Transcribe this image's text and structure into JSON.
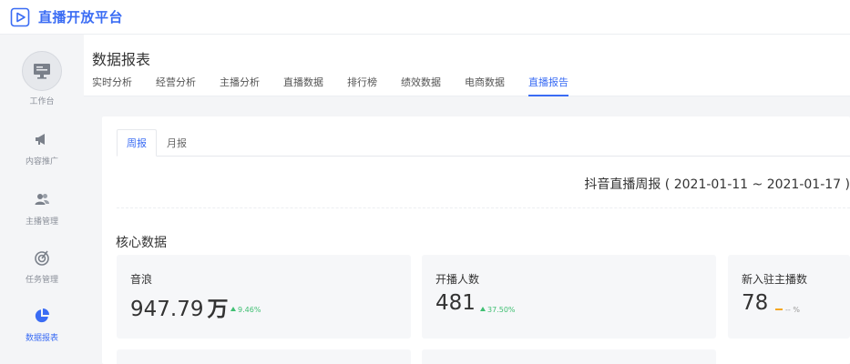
{
  "app": {
    "title": "直播开放平台"
  },
  "sidebar": {
    "items": [
      {
        "label": "工作台",
        "icon": "monitor-icon"
      },
      {
        "label": "内容推广",
        "icon": "megaphone-icon"
      },
      {
        "label": "主播管理",
        "icon": "users-icon"
      },
      {
        "label": "任务管理",
        "icon": "target-icon"
      },
      {
        "label": "数据报表",
        "icon": "pie-chart-icon",
        "active": true
      }
    ]
  },
  "header": {
    "title": "数据报表",
    "tabs": [
      {
        "label": "实时分析"
      },
      {
        "label": "经营分析"
      },
      {
        "label": "主播分析"
      },
      {
        "label": "直播数据"
      },
      {
        "label": "排行榜"
      },
      {
        "label": "绩效数据"
      },
      {
        "label": "电商数据"
      },
      {
        "label": "直播报告",
        "active": true
      }
    ]
  },
  "report": {
    "subtabs": [
      {
        "label": "周报",
        "active": true
      },
      {
        "label": "月报"
      }
    ],
    "title": "抖音直播周报 ( 2021-01-11 ~ 2021-01-17 )",
    "section_title": "核心数据",
    "metrics": [
      {
        "label": "音浪",
        "value": "947.79",
        "unit": "万",
        "change": "9.46%",
        "trend": "up"
      },
      {
        "label": "开播人数",
        "value": "481",
        "unit": "",
        "change": "37.50%",
        "trend": "up"
      },
      {
        "label": "新入驻主播数",
        "value": "78",
        "unit": "",
        "change": "-- %",
        "trend": "flat"
      }
    ]
  },
  "colors": {
    "accent": "#3a6cf4",
    "up": "#3fbf72",
    "flat": "#f5a623"
  }
}
